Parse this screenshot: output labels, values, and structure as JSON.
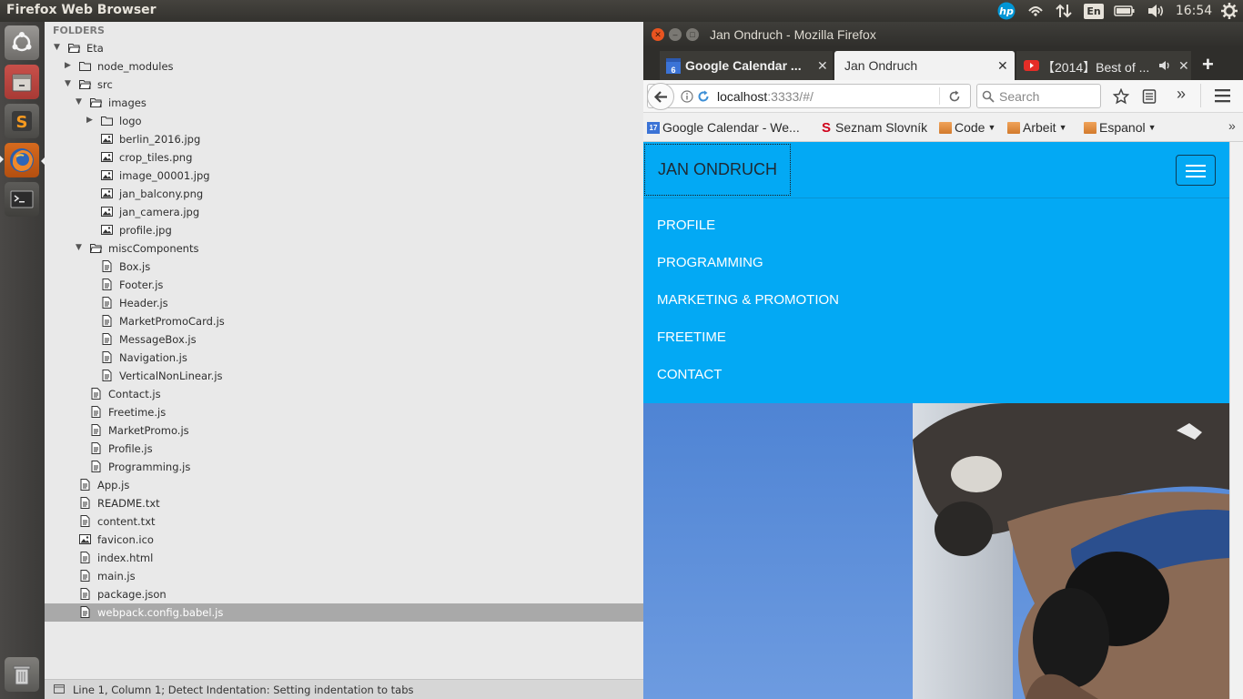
{
  "top_panel": {
    "app_title": "Firefox Web Browser",
    "keyboard_layout": "En",
    "clock": "16:54",
    "indicators": [
      "hp-icon",
      "network-icon",
      "transfer-icon",
      "keyboard-icon",
      "battery-icon",
      "volume-icon",
      "clock",
      "settings-gear-icon"
    ]
  },
  "launcher": {
    "items": [
      "ubuntu-home-icon",
      "files-icon",
      "sublime-text-icon",
      "firefox-icon",
      "terminal-icon",
      "trash-icon"
    ]
  },
  "editor": {
    "folders_label": "FOLDERS",
    "tree": [
      {
        "label": "Eta",
        "type": "folder",
        "depth": 0,
        "expanded": true
      },
      {
        "label": "node_modules",
        "type": "folder",
        "depth": 1,
        "expanded": false
      },
      {
        "label": "src",
        "type": "folder",
        "depth": 1,
        "expanded": true
      },
      {
        "label": "images",
        "type": "folder",
        "depth": 2,
        "expanded": true
      },
      {
        "label": "logo",
        "type": "folder",
        "depth": 3,
        "expanded": false
      },
      {
        "label": "berlin_2016.jpg",
        "type": "image",
        "depth": 3
      },
      {
        "label": "crop_tiles.png",
        "type": "image",
        "depth": 3
      },
      {
        "label": "image_00001.jpg",
        "type": "image",
        "depth": 3
      },
      {
        "label": "jan_balcony.png",
        "type": "image",
        "depth": 3
      },
      {
        "label": "jan_camera.jpg",
        "type": "image",
        "depth": 3
      },
      {
        "label": "profile.jpg",
        "type": "image",
        "depth": 3
      },
      {
        "label": "miscComponents",
        "type": "folder",
        "depth": 2,
        "expanded": true
      },
      {
        "label": "Box.js",
        "type": "file",
        "depth": 3
      },
      {
        "label": "Footer.js",
        "type": "file",
        "depth": 3
      },
      {
        "label": "Header.js",
        "type": "file",
        "depth": 3
      },
      {
        "label": "MarketPromoCard.js",
        "type": "file",
        "depth": 3
      },
      {
        "label": "MessageBox.js",
        "type": "file",
        "depth": 3
      },
      {
        "label": "Navigation.js",
        "type": "file",
        "depth": 3
      },
      {
        "label": "VerticalNonLinear.js",
        "type": "file",
        "depth": 3
      },
      {
        "label": "Contact.js",
        "type": "file",
        "depth": 2
      },
      {
        "label": "Freetime.js",
        "type": "file",
        "depth": 2
      },
      {
        "label": "MarketPromo.js",
        "type": "file",
        "depth": 2
      },
      {
        "label": "Profile.js",
        "type": "file",
        "depth": 2
      },
      {
        "label": "Programming.js",
        "type": "file",
        "depth": 2
      },
      {
        "label": "App.js",
        "type": "file",
        "depth": 1
      },
      {
        "label": "README.txt",
        "type": "file",
        "depth": 1
      },
      {
        "label": "content.txt",
        "type": "file",
        "depth": 1
      },
      {
        "label": "favicon.ico",
        "type": "image",
        "depth": 1
      },
      {
        "label": "index.html",
        "type": "file",
        "depth": 1
      },
      {
        "label": "main.js",
        "type": "file",
        "depth": 1
      },
      {
        "label": "package.json",
        "type": "file",
        "depth": 1
      },
      {
        "label": "webpack.config.babel.js",
        "type": "file",
        "depth": 1,
        "selected": true
      }
    ],
    "status_text": "Line 1, Column 1; Detect Indentation: Setting indentation to tabs"
  },
  "firefox": {
    "window_title": "Jan Ondruch - Mozilla Firefox",
    "tabs": [
      {
        "title": "Google Calendar ...",
        "favicon_text": "6",
        "active": false
      },
      {
        "title": "Jan Ondruch",
        "active": true
      },
      {
        "title": "【2014】Best of ...",
        "active": false
      }
    ],
    "url_host": "localhost",
    "url_rest": ":3333/#/",
    "search_placeholder": "Search",
    "bookmarks": [
      {
        "label": "Google Calendar - We...",
        "icon": "calendar-icon",
        "icon_text": "17"
      },
      {
        "label": "Seznam Slovník",
        "icon": "seznam-icon",
        "icon_text": "S"
      },
      {
        "label": "Code",
        "icon": "folder-icon",
        "dropdown": true
      },
      {
        "label": "Arbeit",
        "icon": "folder-icon",
        "dropdown": true
      },
      {
        "label": "Espanol",
        "icon": "folder-icon",
        "dropdown": true
      }
    ],
    "colors": {
      "page_accent": "#03a9f4",
      "tab_active_bg": "#f2f2f2",
      "tab_inactive_bg": "#3c3b37",
      "youtube_red": "#e52d27",
      "close_button": "#e95420"
    }
  },
  "site": {
    "brand": "JAN ONDRUCH",
    "nav": [
      "PROFILE",
      "PROGRAMMING",
      "MARKETING & PROMOTION",
      "FREETIME",
      "CONTACT"
    ]
  }
}
